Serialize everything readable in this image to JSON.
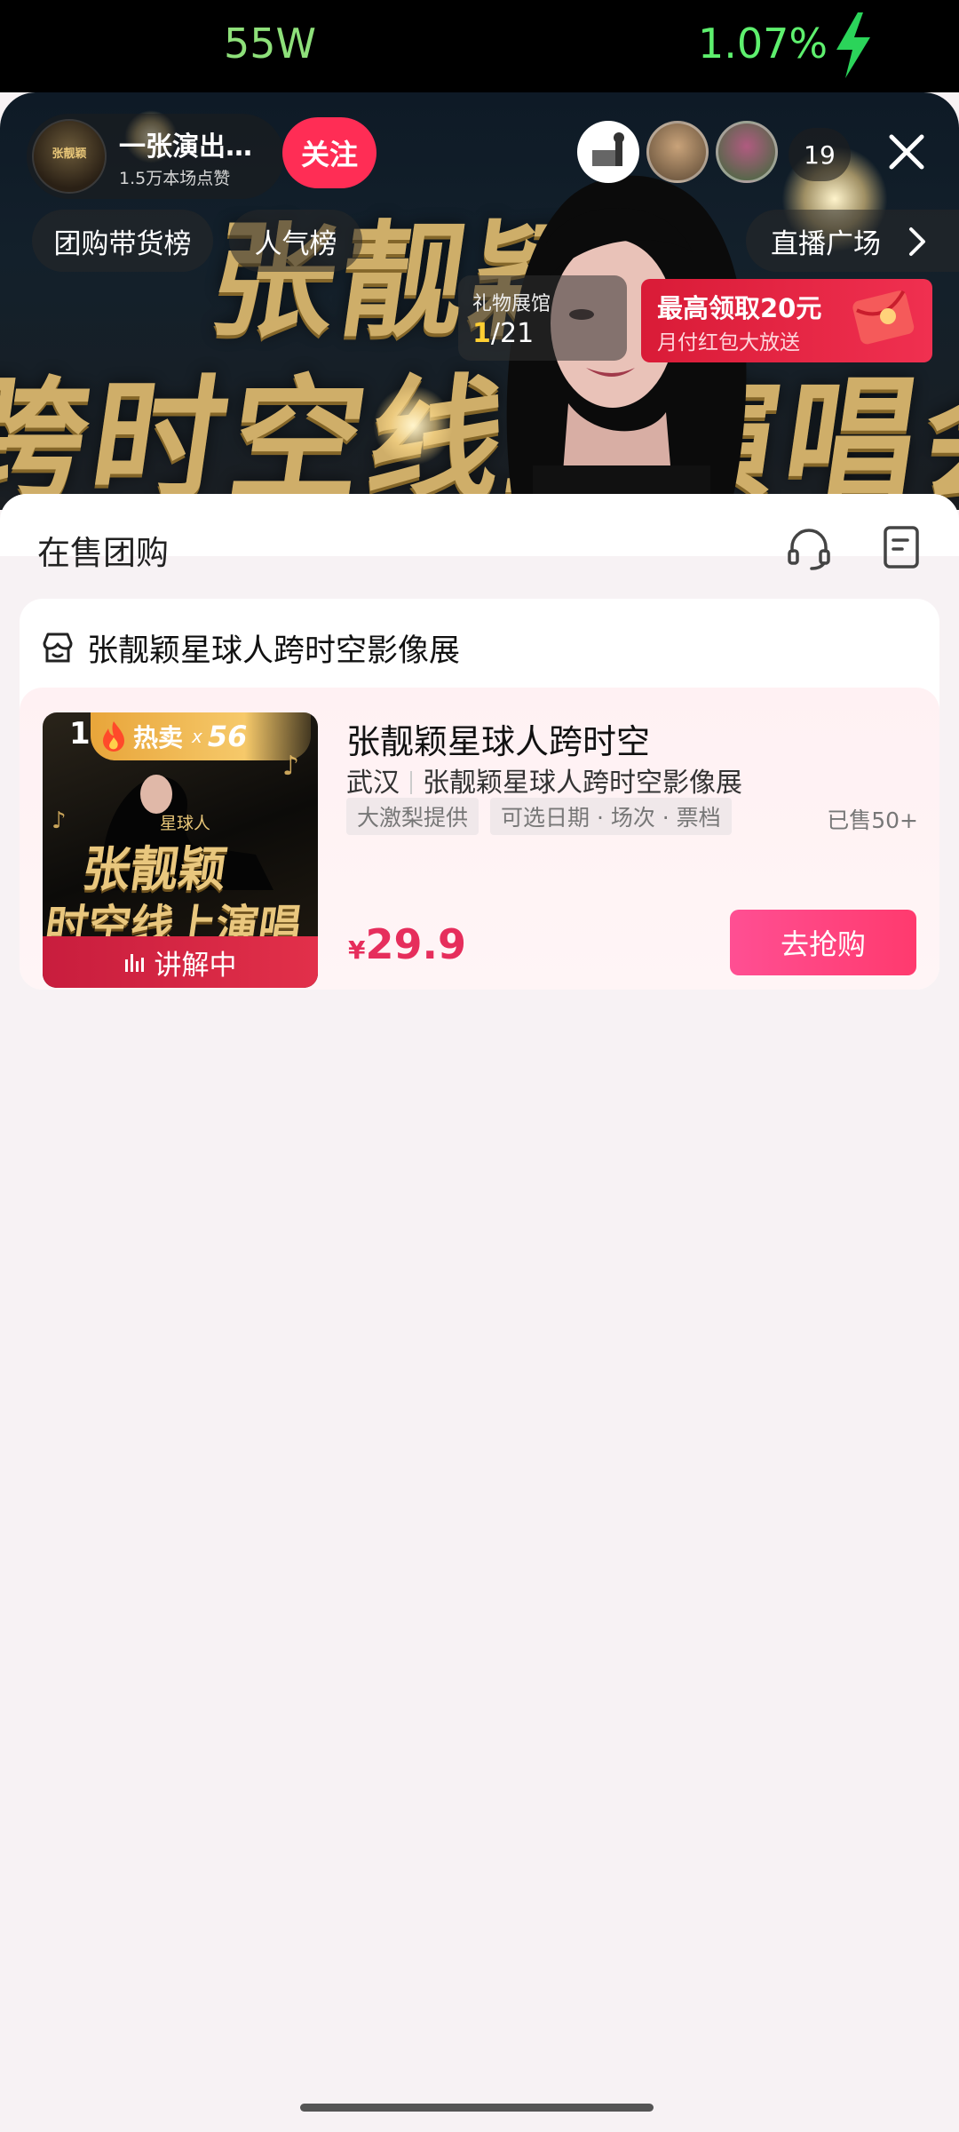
{
  "status_bar": {
    "left_text": "55W",
    "right_text": "1.07%",
    "charging_icon": "lightning-bolt-icon"
  },
  "live": {
    "host_name": "一张演出…",
    "host_likes": "1.5万本场点赞",
    "follow_label": "关注",
    "viewer_count": "19",
    "tags": [
      "团购带货榜",
      "人气榜",
      "直播广场"
    ],
    "gift_hall": {
      "label": "礼物展馆",
      "current": "1",
      "total": "/21"
    },
    "redpack": {
      "title": "最高领取20元",
      "subtitle": "月付红包大放送"
    }
  },
  "sheet": {
    "title": "在售团购",
    "shop_name": "张靓颖星球人跨时空影像展",
    "product": {
      "rank": "1",
      "hot_label": "热卖",
      "hot_multiplier": "x",
      "hot_count": "56",
      "explain_label": "讲解中",
      "title": "张靓颖星球人跨时空",
      "city": "武汉",
      "venue": "张靓颖星球人跨时空影像展",
      "chips": [
        "大激梨提供",
        "可选日期 · 场次 · 票档"
      ],
      "sold": "已售50+",
      "currency": "¥",
      "price": "29.9",
      "buy_label": "去抢购"
    }
  },
  "colors": {
    "accent": "#ff2d55",
    "price": "#e62e5c",
    "buy_button": "#ff4f93",
    "gold": "#d9b66d"
  }
}
